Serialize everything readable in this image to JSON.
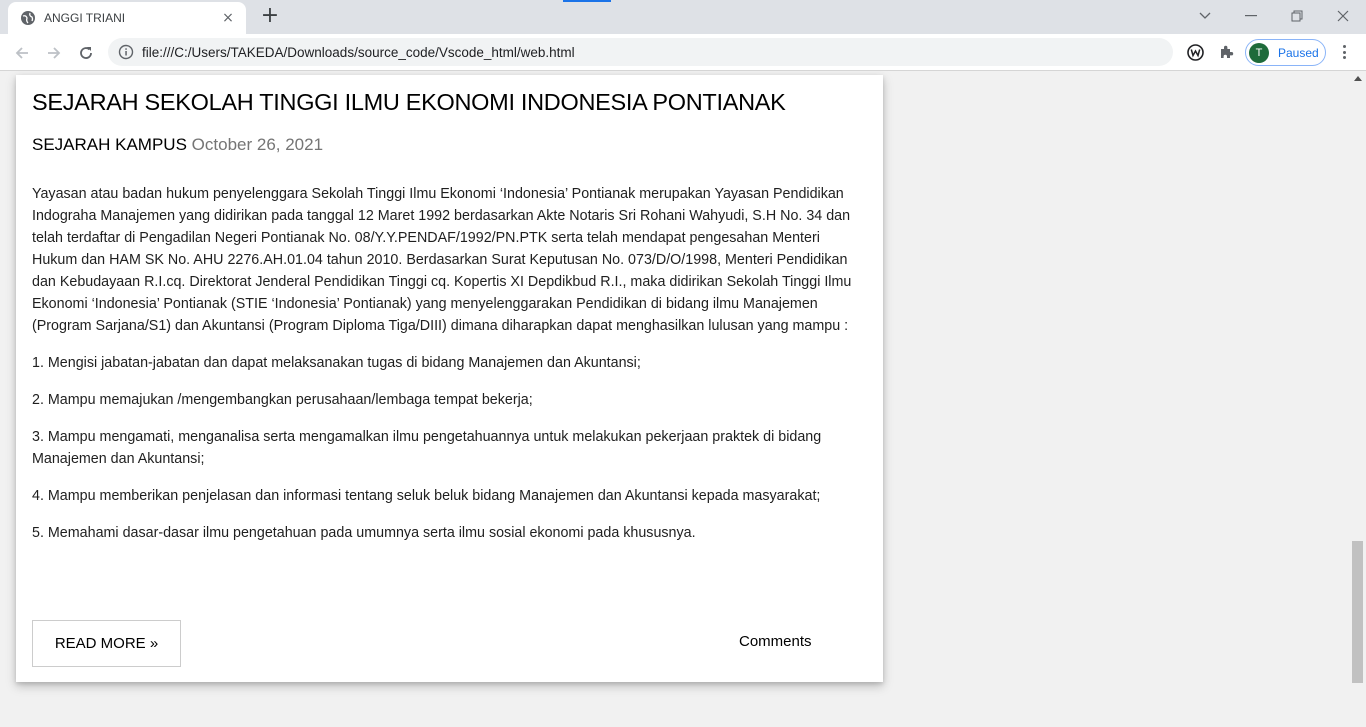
{
  "browser": {
    "tab_title": "ANGGI TRIANI",
    "new_tab_symbol": "+",
    "close_symbol": "×",
    "url": "file:///C:/Users/TAKEDA/Downloads/source_code/Vscode_html/web.html",
    "profile_initial": "T",
    "profile_status": "Paused"
  },
  "post": {
    "title": "SEJARAH SEKOLAH TINGGI ILMU EKONOMI INDONESIA PONTIANAK",
    "category": "SEJARAH KAMPUS",
    "date": "October 26, 2021",
    "paragraphs": [
      "Yayasan atau badan hukum penyelenggara Sekolah Tinggi Ilmu Ekonomi ‘Indonesia’ Pontianak merupakan Yayasan Pendidikan Indograha Manajemen yang didirikan pada tanggal 12 Maret 1992 berdasarkan Akte Notaris Sri Rohani Wahyudi, S.H No. 34 dan telah terdaftar di Pengadilan Negeri Pontianak No. 08/Y.Y.PENDAF/1992/PN.PTK serta telah mendapat pengesahan Menteri Hukum dan HAM SK No. AHU 2276.AH.01.04 tahun 2010. Berdasarkan Surat Keputusan No. 073/D/O/1998, Menteri Pendidikan dan Kebudayaan R.I.cq. Direktorat Jenderal Pendidikan Tinggi cq. Kopertis XI Depdikbud R.I., maka didirikan Sekolah Tinggi Ilmu Ekonomi ‘Indonesia’ Pontianak (STIE ‘Indonesia’ Pontianak) yang menyelenggarakan Pendidikan di bidang ilmu Manajemen (Program Sarjana/S1) dan Akuntansi (Program Diploma Tiga/DIII) dimana diharapkan dapat menghasilkan lulusan yang mampu :",
      "1. Mengisi jabatan-jabatan dan dapat melaksanakan tugas di bidang Manajemen dan Akuntansi;",
      "2. Mampu memajukan /mengembangkan perusahaan/lembaga tempat bekerja;",
      "3. Mampu mengamati, menganalisa serta mengamalkan ilmu pengetahuannya untuk melakukan pekerjaan praktek di bidang Manajemen dan Akuntansi;",
      "4. Mampu memberikan penjelasan dan informasi tentang seluk beluk bidang Manajemen dan Akuntansi kepada masyarakat;",
      "5. Memahami dasar-dasar ilmu pengetahuan pada umumnya serta ilmu sosial ekonomi pada khususnya."
    ],
    "read_more_label": "READ MORE »",
    "comments_label": "Comments"
  },
  "icons": {
    "tab_favicon": "globe-icon",
    "back": "arrow-left-icon",
    "forward": "arrow-right-icon",
    "reload": "reload-icon",
    "site_info": "info-icon",
    "extension_1": "w-circle-icon",
    "extension_2": "puzzle-icon",
    "menu": "kebab-menu-icon"
  },
  "colors": {
    "page_background": "#f1f1f1",
    "card_background": "#ffffff",
    "date_color": "#757575",
    "profile_accent": "#1a73e8",
    "avatar": "#1e6b3a"
  }
}
